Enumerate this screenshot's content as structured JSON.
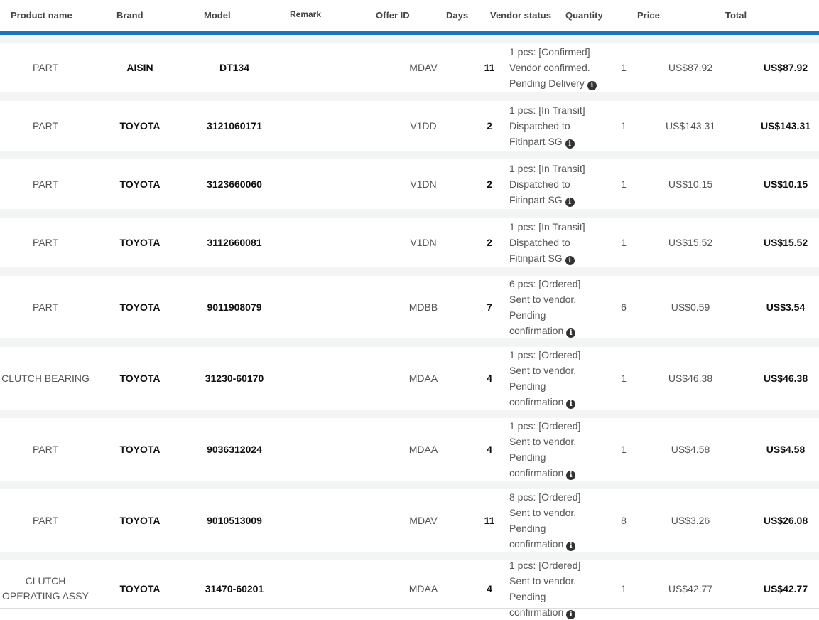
{
  "header": {
    "product_name": "Product name",
    "brand": "Brand",
    "model": "Model",
    "remark": "Remark",
    "offer_id": "Offer ID",
    "days": "Days",
    "vendor_status": "Vendor status",
    "quantity": "Quantity",
    "price": "Price",
    "total": "Total"
  },
  "colors": {
    "accent": "#1b75bc",
    "row_gap": "#f3f4f4"
  },
  "rows": [
    {
      "product": "PART",
      "brand": "AISIN",
      "model": "DT134",
      "remark": "",
      "offer_id": "MDAV",
      "days": "11",
      "status": [
        "1 pcs: [Confirmed]",
        "Vendor confirmed.",
        "Pending Delivery"
      ],
      "quantity": "1",
      "price": "US$87.92",
      "total": "US$87.92"
    },
    {
      "product": "PART",
      "brand": "TOYOTA",
      "model": "3121060171",
      "remark": "",
      "offer_id": "V1DD",
      "days": "2",
      "status": [
        "1 pcs: [In Transit]",
        "Dispatched to",
        "Fitinpart SG"
      ],
      "quantity": "1",
      "price": "US$143.31",
      "total": "US$143.31"
    },
    {
      "product": "PART",
      "brand": "TOYOTA",
      "model": "3123660060",
      "remark": "",
      "offer_id": "V1DN",
      "days": "2",
      "status": [
        "1 pcs: [In Transit]",
        "Dispatched to",
        "Fitinpart SG"
      ],
      "quantity": "1",
      "price": "US$10.15",
      "total": "US$10.15"
    },
    {
      "product": "PART",
      "brand": "TOYOTA",
      "model": "3112660081",
      "remark": "",
      "offer_id": "V1DN",
      "days": "2",
      "status": [
        "1 pcs: [In Transit]",
        "Dispatched to",
        "Fitinpart SG"
      ],
      "quantity": "1",
      "price": "US$15.52",
      "total": "US$15.52"
    },
    {
      "product": "PART",
      "brand": "TOYOTA",
      "model": "9011908079",
      "remark": "",
      "offer_id": "MDBB",
      "days": "7",
      "status": [
        "6 pcs: [Ordered]",
        "Sent to vendor.",
        "Pending",
        "confirmation"
      ],
      "quantity": "6",
      "price": "US$0.59",
      "total": "US$3.54"
    },
    {
      "product": "CLUTCH BEARING",
      "brand": "TOYOTA",
      "model": "31230-60170",
      "remark": "",
      "offer_id": "MDAA",
      "days": "4",
      "status": [
        "1 pcs: [Ordered]",
        "Sent to vendor.",
        "Pending",
        "confirmation"
      ],
      "quantity": "1",
      "price": "US$46.38",
      "total": "US$46.38"
    },
    {
      "product": "PART",
      "brand": "TOYOTA",
      "model": "9036312024",
      "remark": "",
      "offer_id": "MDAA",
      "days": "4",
      "status": [
        "1 pcs: [Ordered]",
        "Sent to vendor.",
        "Pending",
        "confirmation"
      ],
      "quantity": "1",
      "price": "US$4.58",
      "total": "US$4.58"
    },
    {
      "product": "PART",
      "brand": "TOYOTA",
      "model": "9010513009",
      "remark": "",
      "offer_id": "MDAV",
      "days": "11",
      "status": [
        "8 pcs: [Ordered]",
        "Sent to vendor.",
        "Pending",
        "confirmation"
      ],
      "quantity": "8",
      "price": "US$3.26",
      "total": "US$26.08"
    },
    {
      "product": "CLUTCH OPERATING ASSY",
      "brand": "TOYOTA",
      "model": "31470-60201",
      "remark": "",
      "offer_id": "MDAA",
      "days": "4",
      "status": [
        "1 pcs: [Ordered]",
        "Sent to vendor.",
        "Pending",
        "confirmation"
      ],
      "quantity": "1",
      "price": "US$42.77",
      "total": "US$42.77"
    }
  ],
  "icons": {
    "status_info": "info-icon"
  }
}
